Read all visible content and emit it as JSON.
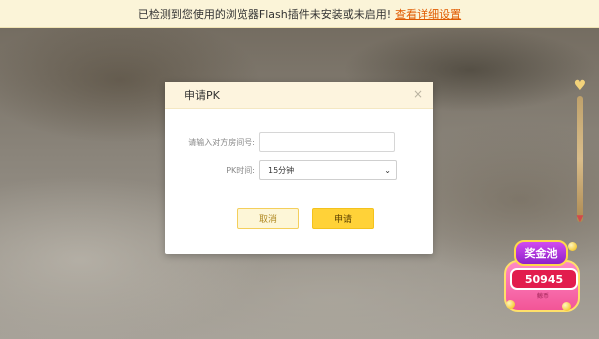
{
  "notice": {
    "message": "已检测到您使用的浏览器Flash插件未安装或未启用!",
    "link": "查看详细设置"
  },
  "dialog": {
    "title": "申请PK",
    "close_glyph": "×",
    "room_label": "请输入对方房间号:",
    "room_value": "",
    "time_label": "PK时间:",
    "time_selected": "15分钟",
    "cancel_label": "取消",
    "apply_label": "申请"
  },
  "prize_pool": {
    "title": "奖金池",
    "amount": "50945",
    "unit": "鲸币"
  },
  "icons": {
    "close": "close-icon",
    "chevron": "chevron-down-icon",
    "heart": "heart-icon",
    "arrow": "arrow-down-icon"
  },
  "colors": {
    "notice_bg": "#fbf4d8",
    "link": "#e05a00",
    "dialog_header_bg": "#fdf4de",
    "apply_button": "#ffd238",
    "cancel_button_border": "#f4cf5c",
    "pool_amount_bg": "#e21c4d"
  }
}
